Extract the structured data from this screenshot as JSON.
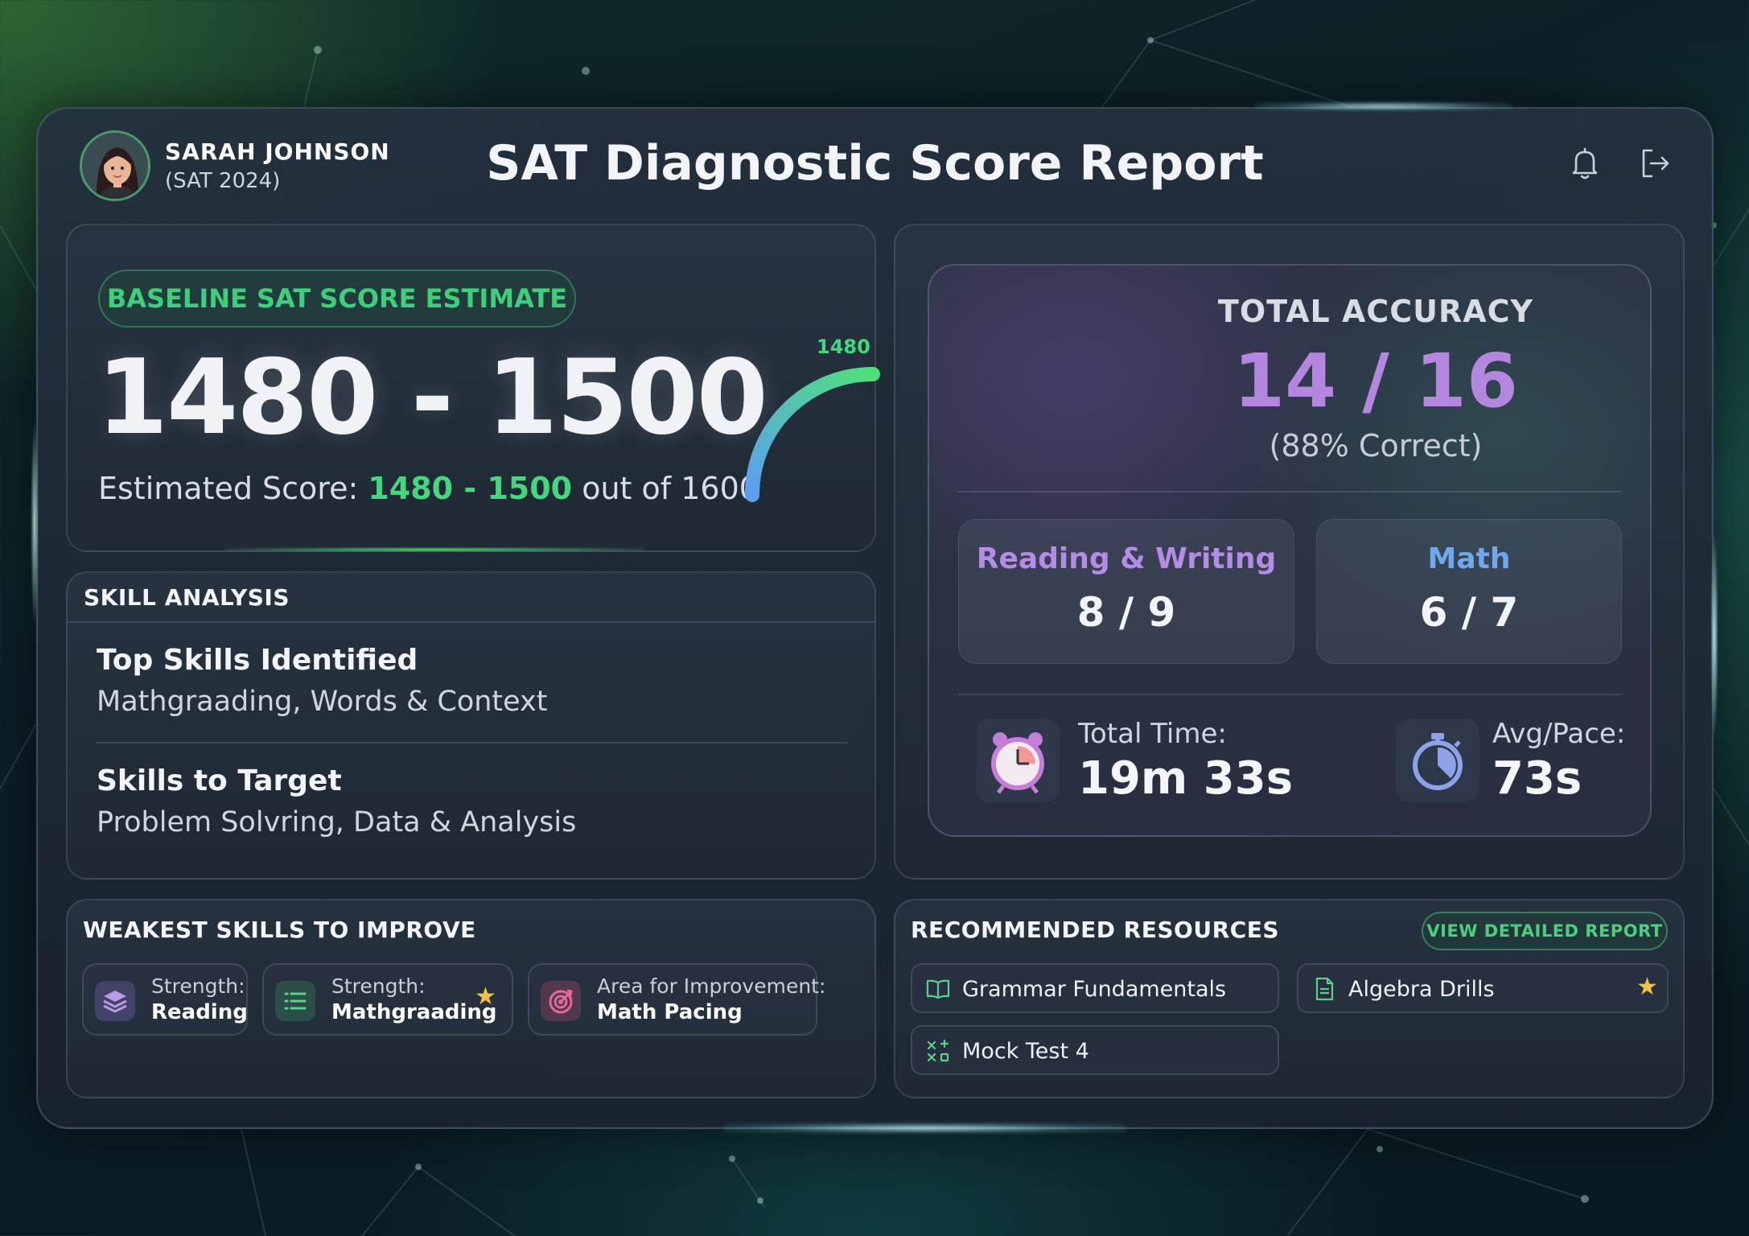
{
  "user": {
    "name": "SARAH JOHNSON",
    "subtitle": "(SAT 2024)"
  },
  "header": {
    "title": "SAT Diagnostic Score Report",
    "icons": [
      "bell-icon",
      "logout-icon"
    ]
  },
  "baseline": {
    "badge": "BASELINE SAT SCORE ESTIMATE",
    "range": "1480 - 1500",
    "estimate_prefix": "Estimated Score: ",
    "estimate_range": "1480 - 1500",
    "estimate_suffix": " out of 1600",
    "gauge_label": "1480",
    "gauge_value": 1480,
    "gauge_max": 1600
  },
  "skill_analysis": {
    "heading": "SKILL ANALYSIS",
    "top_title": "Top Skills Identified",
    "top_value": "Mathgraading, Words & Context",
    "target_title": "Skills to Target",
    "target_value": "Problem Solvring, Data & Analysis"
  },
  "accuracy": {
    "label": "TOTAL ACCURACY",
    "value": "14 / 16",
    "sub": "(88% Correct)",
    "sections": [
      {
        "label": "Reading & Writing",
        "value": "8 / 9",
        "color": "#b48ce6"
      },
      {
        "label": "Math",
        "value": "6 / 7",
        "color": "#6fa9ec"
      }
    ],
    "total_time_label": "Total Time:",
    "total_time_value": "19m 33s",
    "pace_label": "Avg/Pace:",
    "pace_value": "73s"
  },
  "weakest": {
    "heading": "WEAKEST SKILLS TO IMPROVE",
    "chips": [
      {
        "line1": "Strength:",
        "line2": "Reading",
        "icon": "layers-icon"
      },
      {
        "line1": "Strength:",
        "line2": "Mathgraading",
        "icon": "list-icon",
        "starred": true
      },
      {
        "line1": "Area for Improvement:",
        "line2": "Math Pacing",
        "icon": "target-icon"
      }
    ]
  },
  "resources": {
    "heading": "RECOMMENDED RESOURCES",
    "view_button": "VIEW DETAILED REPORT",
    "items": [
      {
        "label": "Grammar Fundamentals",
        "icon": "book-icon"
      },
      {
        "label": "Algebra Drills",
        "icon": "document-icon",
        "starred": true
      },
      {
        "label": "Mock Test 4",
        "icon": "math-symbols-icon"
      }
    ]
  },
  "colors": {
    "accent_green": "#45d67e",
    "accent_purple": "#b586e0",
    "accent_blue": "#6fa9ec",
    "star": "#f5c242"
  }
}
